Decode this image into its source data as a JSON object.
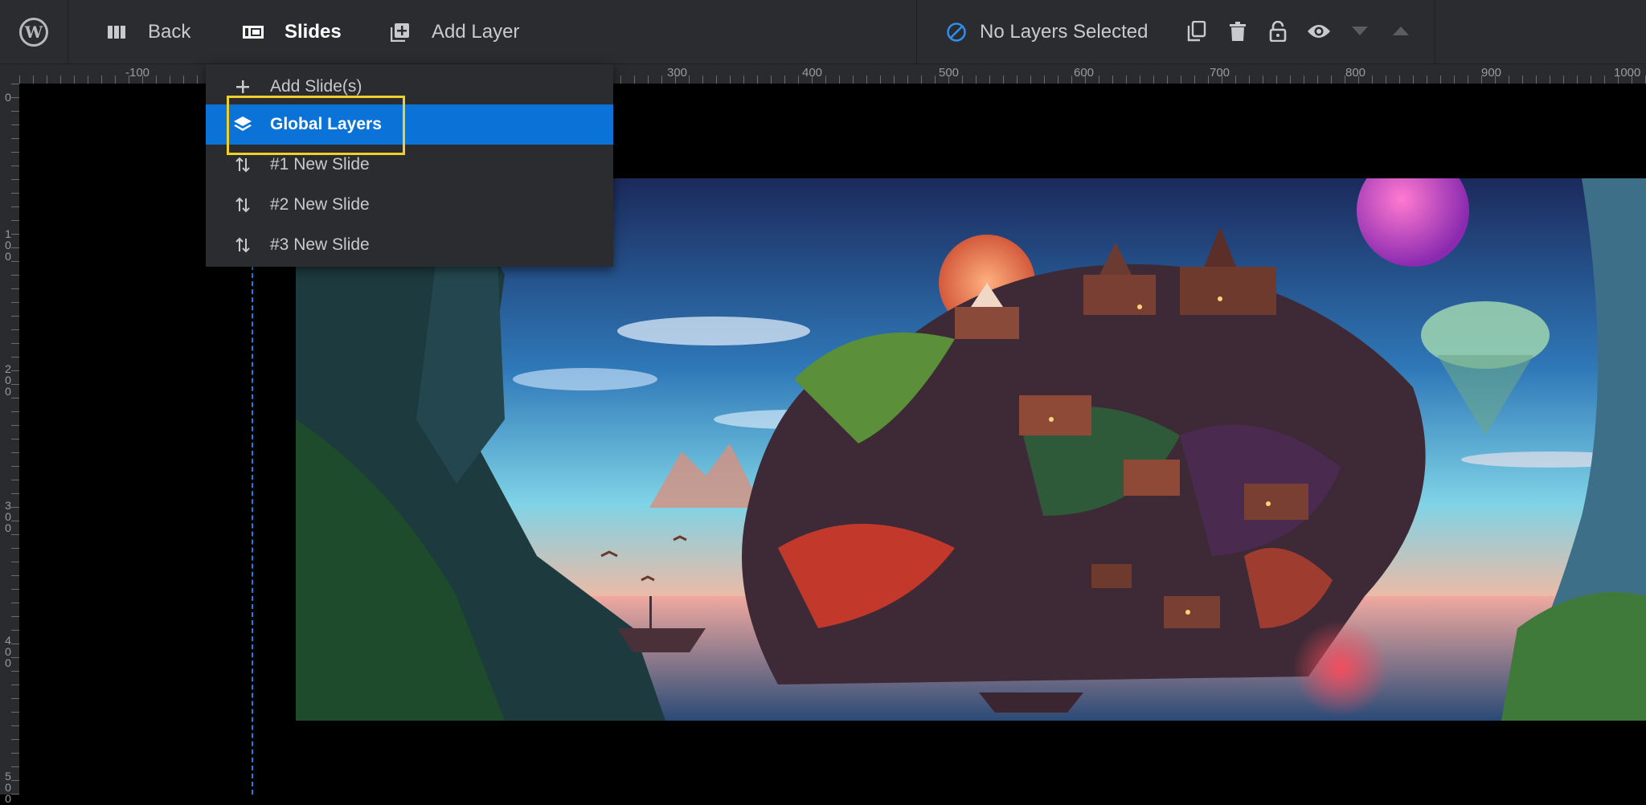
{
  "toolbar": {
    "back_label": "Back",
    "slides_label": "Slides",
    "add_layer_label": "Add Layer",
    "no_layers_label": "No Layers Selected"
  },
  "ruler": {
    "horizontal_ticks": [
      "-100",
      "300",
      "400",
      "500",
      "600",
      "700",
      "800",
      "900",
      "1000"
    ],
    "vertical_ticks": [
      "0",
      "100",
      "200",
      "300",
      "400",
      "500"
    ]
  },
  "dropdown": {
    "items": [
      {
        "label": "Add Slide(s)",
        "icon": "plus-icon"
      },
      {
        "label": "Global Layers",
        "icon": "layers-icon"
      },
      {
        "label": "#1 New Slide",
        "icon": "sort-arrows-icon"
      },
      {
        "label": "#2 New Slide",
        "icon": "sort-arrows-icon"
      },
      {
        "label": "#3 New Slide",
        "icon": "sort-arrows-icon"
      }
    ],
    "highlighted_index": 1
  },
  "colors": {
    "toolbar_bg": "#2b2c2f",
    "highlight": "#0b72d8",
    "focus_outline": "#f1cf2a",
    "guide": "#1e7fe0"
  }
}
